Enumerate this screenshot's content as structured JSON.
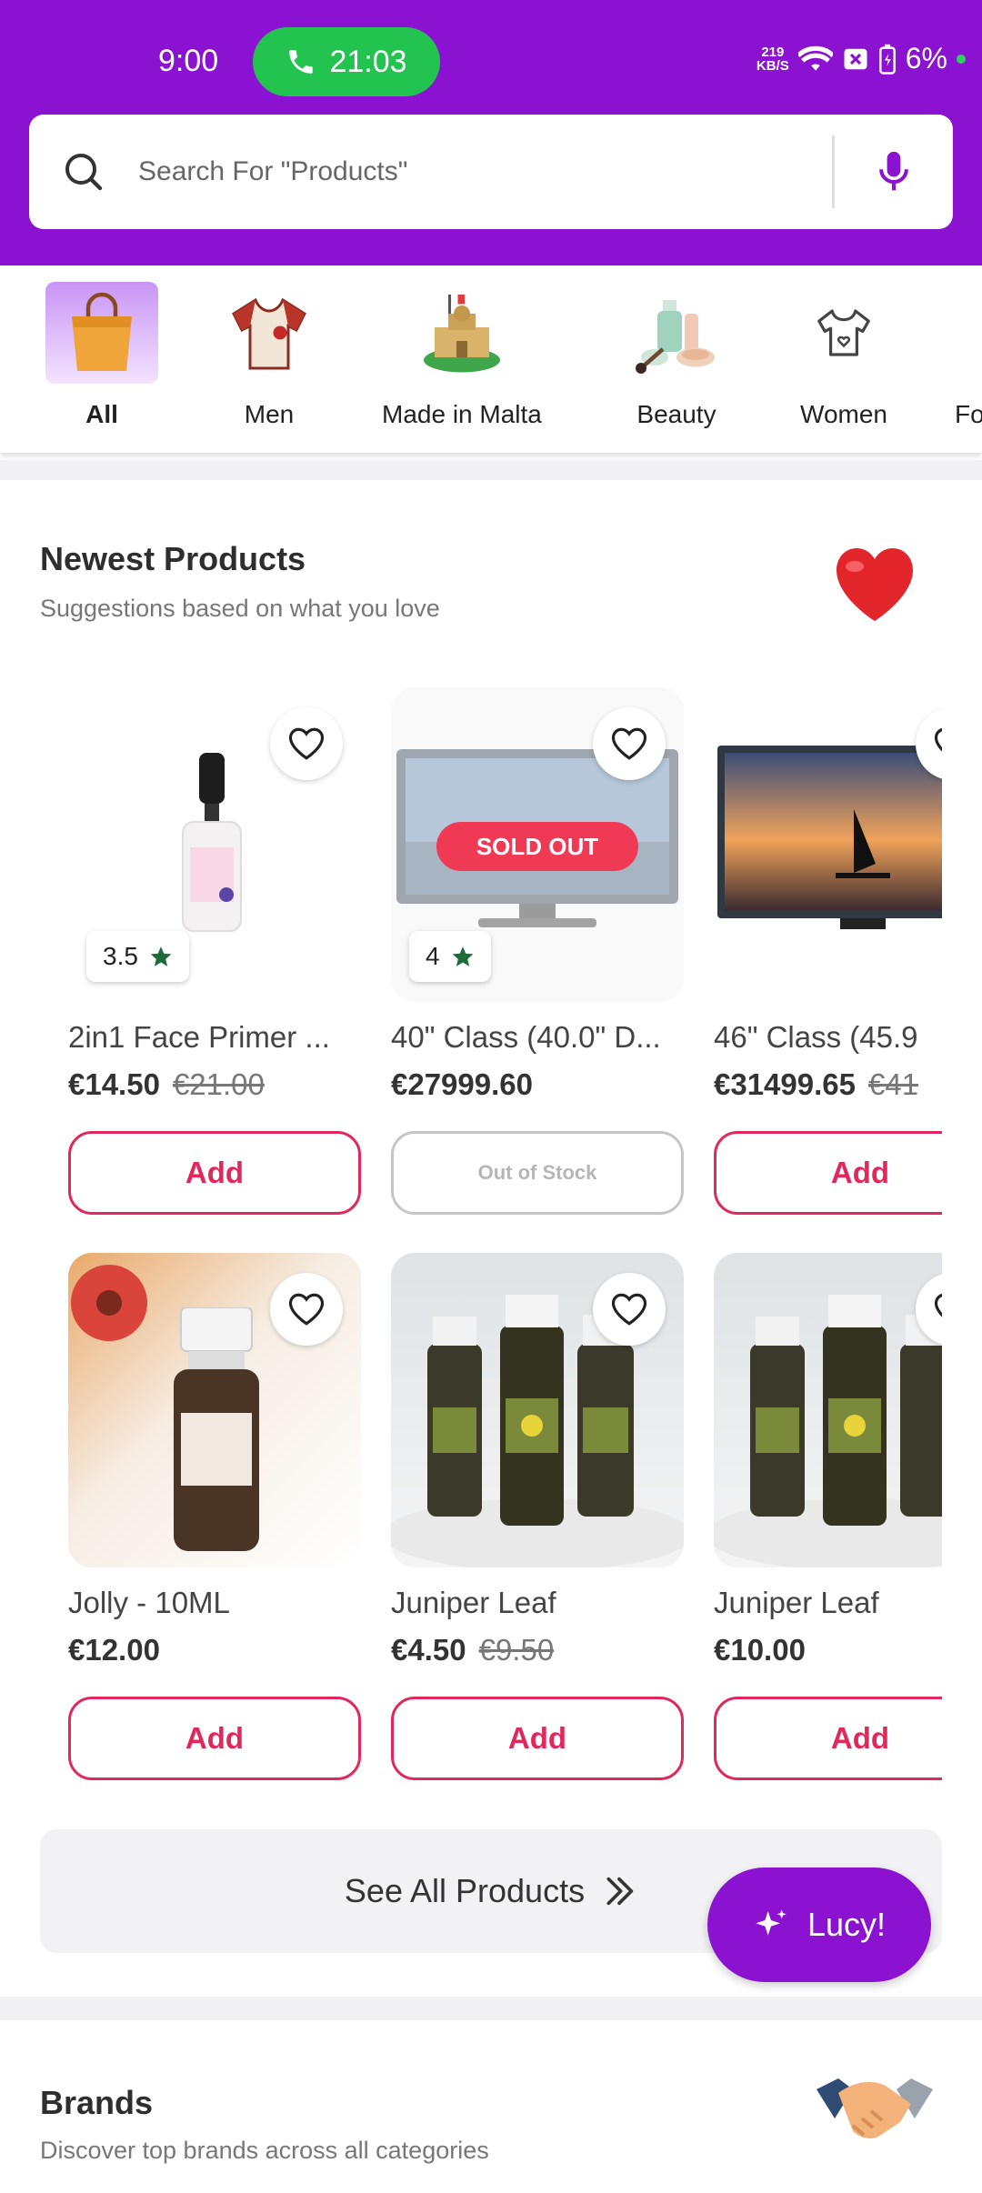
{
  "status_bar": {
    "time": "9:00",
    "call_timer": "21:03",
    "net_speed_top": "219",
    "net_speed_bottom": "KB/S",
    "battery": "6%"
  },
  "search": {
    "placeholder": "Search For \"Products\""
  },
  "categories": [
    {
      "label": "All",
      "icon": "shopping-bag-icon",
      "active": true
    },
    {
      "label": "Men",
      "icon": "shirt-icon"
    },
    {
      "label": "Made in Malta",
      "icon": "malta-castle-icon"
    },
    {
      "label": "Beauty",
      "icon": "cosmetics-icon"
    },
    {
      "label": "Women",
      "icon": "women-top-icon"
    },
    {
      "label": "Fo",
      "icon": ""
    }
  ],
  "newest": {
    "title": "Newest Products",
    "subtitle": "Suggestions based on what you love",
    "products": [
      {
        "name": "2in1 Face Primer ...",
        "price": "€14.50",
        "old_price": "€21.00",
        "rating": "3.5",
        "button": "Add"
      },
      {
        "name": "40\" Class (40.0\" D...",
        "price": "€27999.60",
        "old_price": "",
        "rating": "4",
        "badge": "SOLD OUT",
        "button": "Out of Stock"
      },
      {
        "name": "46\" Class (45.9",
        "price": "€31499.65",
        "old_price": "€41",
        "button": "Add"
      },
      {
        "name": "Jolly - 10ML",
        "price": "€12.00",
        "old_price": "",
        "button": "Add"
      },
      {
        "name": "Juniper Leaf",
        "price": "€4.50",
        "old_price": "€9.50",
        "button": "Add"
      },
      {
        "name": "Juniper Leaf",
        "price": "€10.00",
        "old_price": "",
        "button": "Add"
      }
    ],
    "see_all": "See All Products"
  },
  "assistant": {
    "label": "Lucy!"
  },
  "brands": {
    "title": "Brands",
    "subtitle": "Discover top brands across all categories"
  },
  "colors": {
    "brand": "#8b12d0",
    "accent": "#e2275d",
    "call": "#22c34f"
  }
}
